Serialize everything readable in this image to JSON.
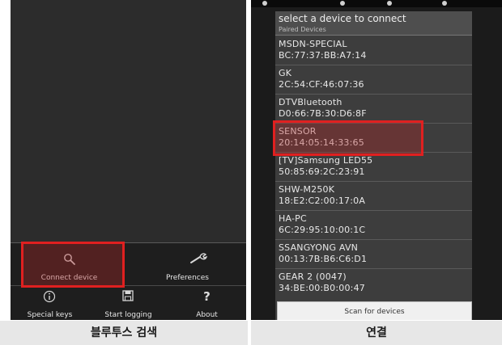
{
  "left_screen": {
    "menu": {
      "connect_device": "Connect device",
      "preferences": "Preferences",
      "special_keys": "Special keys",
      "start_logging": "Start logging",
      "about": "About",
      "about_glyph": "?"
    }
  },
  "right_screen": {
    "dialog": {
      "title": "select a device to connect",
      "subtitle": "Paired Devices",
      "devices": [
        {
          "name": "MSDN-SPECIAL",
          "address": "BC:77:37:BB:A7:14"
        },
        {
          "name": "GK",
          "address": "2C:54:CF:46:07:36"
        },
        {
          "name": "DTVBluetooth",
          "address": "D0:66:7B:30:D6:8F"
        },
        {
          "name": "SENSOR",
          "address": "20:14:05:14:33:65"
        },
        {
          "name": "[TV]Samsung LED55",
          "address": "50:85:69:2C:23:91"
        },
        {
          "name": "SHW-M250K",
          "address": "18:E2:C2:00:17:0A"
        },
        {
          "name": "HA-PC",
          "address": "6C:29:95:10:00:1C"
        },
        {
          "name": "SSANGYONG AVN",
          "address": "00:13:7B:B6:C6:D1"
        },
        {
          "name": "GEAR 2 (0047)",
          "address": "34:BE:00:B0:00:47"
        }
      ],
      "scan_button": "Scan for devices"
    }
  },
  "captions": {
    "left": "블루투스 검색",
    "right": "연결"
  },
  "colors": {
    "highlight": "#e02020"
  }
}
